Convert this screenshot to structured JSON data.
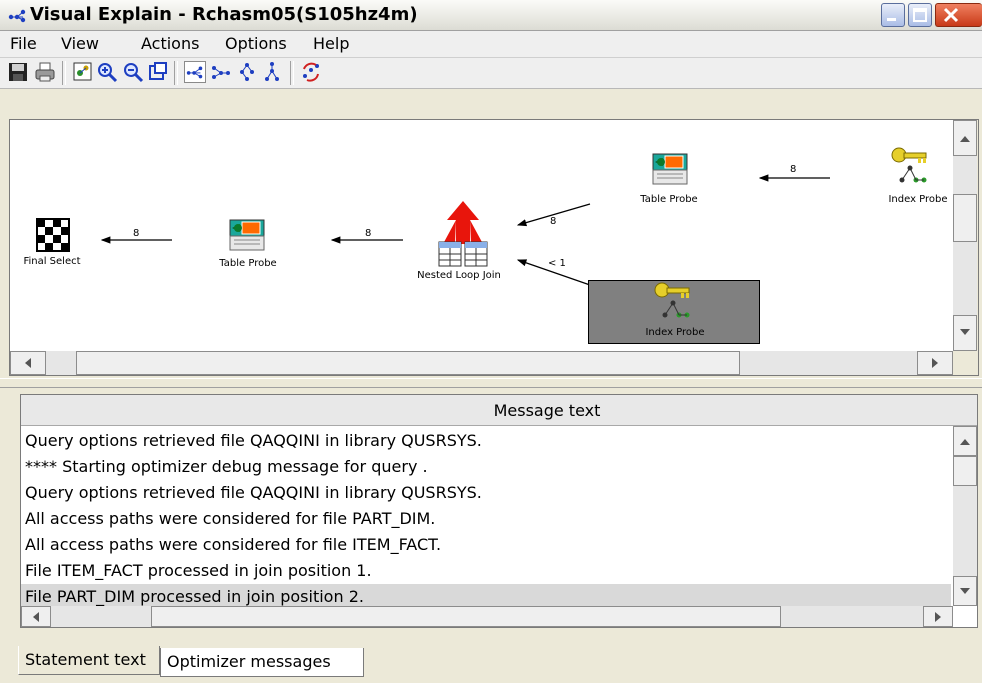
{
  "window": {
    "title": "Visual Explain - Rchasm05(S105hz4m)",
    "controls": [
      "minimize",
      "maximize",
      "close"
    ]
  },
  "menu": [
    "File",
    "View",
    "Actions",
    "Options",
    "Help"
  ],
  "toolbar": {
    "icons": [
      "save-icon",
      "print-icon",
      "overview-icon",
      "zoom-in-icon",
      "zoom-out-icon",
      "fit-window-icon",
      "layout-horizontal-icon",
      "layout-horizontal-alt-icon",
      "layout-vertical-icon",
      "layout-vertical-alt-icon",
      "refresh-layout-icon"
    ]
  },
  "graph": {
    "nodes": {
      "final_select": "Final Select",
      "table_probe_1": "Table Probe",
      "nested_loop_join": "Nested Loop Join",
      "table_probe_2": "Table Probe",
      "index_probe_1": "Index Probe",
      "index_probe_2": "Index Probe"
    },
    "edges": {
      "e_table_probe_to_final": "8",
      "e_join_to_table_probe": "8",
      "e_table_probe2_to_join": "8",
      "e_index_probe_to_table_probe2": "8",
      "e_index_probe2_to_join": "< 1"
    }
  },
  "messages": {
    "header": "Message text",
    "rows": [
      "Query options retrieved file QAQQINI in library QUSRSYS.",
      "**** Starting optimizer debug message for query .",
      "Query options retrieved file QAQQINI in library QUSRSYS.",
      "All access paths were considered for file PART_DIM.",
      "All access paths were considered for file ITEM_FACT.",
      "File ITEM_FACT processed in join position 1.",
      "File PART_DIM processed in join position 2."
    ],
    "selected_index": 6
  },
  "tabs": {
    "statement": "Statement text",
    "optimizer": "Optimizer messages"
  },
  "colors": {
    "selection": "#d9d9d9",
    "node_highlight": "#808080",
    "join_arrow": "#e8150c",
    "key_icon": "#e6cf2a",
    "table_icon": "#ff6a00"
  }
}
